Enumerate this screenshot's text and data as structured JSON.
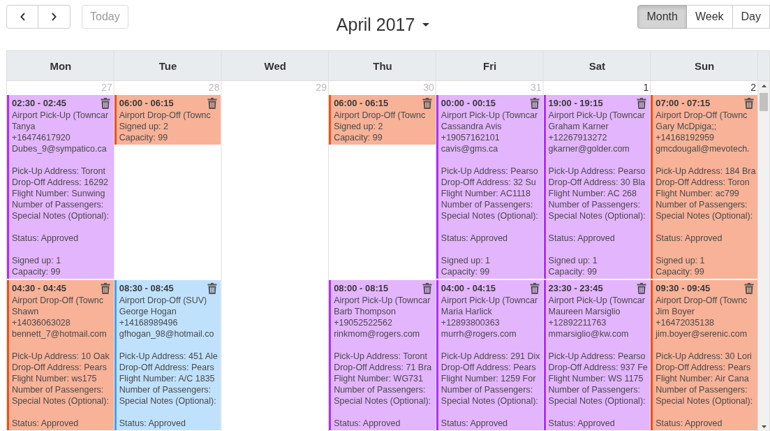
{
  "toolbar": {
    "today": {
      "label": "Today",
      "disabled": true
    },
    "title": "April 2017",
    "views": [
      {
        "label": "Month",
        "selected": true
      },
      {
        "label": "Week",
        "selected": false
      },
      {
        "label": "Day",
        "selected": false
      }
    ]
  },
  "weekdays": [
    "Mon",
    "Tue",
    "Wed",
    "Thu",
    "Fri",
    "Sat",
    "Sun"
  ],
  "days": [
    {
      "date": "27",
      "other_month": true,
      "events": [
        {
          "time": "02:30 - 02:45",
          "color": "#e3b5fd",
          "groups": [
            [
              "Airport Pick-Up (Towncar",
              "Tanya",
              "+16474617920",
              "Dubes_9@sympatico.ca"
            ],
            [
              "Pick-Up Address: Toront",
              "Drop-Off Address: 16292",
              "Flight Number: Sunwing",
              "Number of Passengers:",
              "Special Notes (Optional):"
            ],
            [
              "Status: Approved"
            ],
            [
              "Signed up: 1",
              "Capacity: 99"
            ]
          ]
        },
        {
          "time": "04:30 - 04:45",
          "color": "#f7b298",
          "groups": [
            [
              "Airport Drop-Off (Townc",
              "Shawn",
              "+14036063028",
              "bennett_7@hotmail.com"
            ],
            [
              "Pick-Up Address: 10 Oak",
              "Drop-Off Address: Pears",
              "Flight Number: ws175",
              "Number of Passengers:",
              "Special Notes (Optional):"
            ],
            [
              "Status: Approved"
            ]
          ]
        }
      ]
    },
    {
      "date": "28",
      "other_month": true,
      "events": [
        {
          "time": "06:00 - 06:15",
          "color": "#f7b298",
          "groups": [
            [
              "Airport Drop-Off (Townc",
              "Signed up: 2",
              "Capacity: 99"
            ]
          ]
        },
        {
          "time": "08:30 - 08:45",
          "color": "#bfe1fc",
          "groups": [
            [
              "Airport Drop-Off (SUV)",
              "George Hogan",
              "+14168989496",
              "gfhogan_98@hotmail.co"
            ],
            [
              "Pick-Up Address: 451 Ale",
              "Drop-Off Address: Pears",
              "Flight Number: A/C 1835",
              "Number of Passengers:",
              "Special Notes (Optional):"
            ],
            [
              "Status: Approved"
            ]
          ]
        }
      ]
    },
    {
      "date": "29",
      "other_month": true
    },
    {
      "date": "30",
      "other_month": true,
      "events": [
        {
          "time": "06:00 - 06:15",
          "color": "#f7b298",
          "groups": [
            [
              "Airport Drop-Off (Townc",
              "Signed up: 2",
              "Capacity: 99"
            ]
          ]
        },
        {
          "time": "08:00 - 08:15",
          "color": "#e3b5fd",
          "groups": [
            [
              "Airport Pick-Up (Towncar",
              "Barb Thompson",
              "+19052522562",
              "rinkmom@rogers.com"
            ],
            [
              "Pick-Up Address: Toront",
              "Drop-Off Address: 71 Bra",
              "Flight Number: WG731",
              "Number of Passengers:",
              "Special Notes (Optional):"
            ],
            [
              "Status: Approved"
            ]
          ]
        }
      ]
    },
    {
      "date": "31",
      "other_month": true,
      "events": [
        {
          "time": "00:00 - 00:15",
          "color": "#e3b5fd",
          "groups": [
            [
              "Airport Pick-Up (Towncar",
              "Cassandra Avis",
              "+19057162101",
              "cavis@gms.ca"
            ],
            [
              "Pick-Up Address: Pearso",
              "Drop-Off Address: 32 Su",
              "Flight Number: AC1118",
              "Number of Passengers:",
              "Special Notes (Optional):"
            ],
            [
              "Status: Approved"
            ],
            [
              "Signed up: 1",
              "Capacity: 99"
            ]
          ]
        },
        {
          "time": "04:00 - 04:15",
          "color": "#e3b5fd",
          "groups": [
            [
              "Airport Pick-Up (Towncar",
              "Maria Harlick",
              "+12893800363",
              "murrh@rogers.com"
            ],
            [
              "Pick-Up Address: 291 Dix",
              "Drop-Off Address: Pears",
              "Flight Number: 1259 For",
              "Number of Passengers:",
              "Special Notes (Optional):"
            ],
            [
              "Status: Approved"
            ]
          ]
        }
      ]
    },
    {
      "date": "1",
      "other_month": false,
      "events": [
        {
          "time": "19:00 - 19:15",
          "color": "#e3b5fd",
          "groups": [
            [
              "Airport Pick-Up (Towncar",
              "Graham Karner",
              "+12267913272",
              "gkarner@golder.com"
            ],
            [
              "Pick-Up Address: Pearso",
              "Drop-Off Address: 30 Bla",
              "Flight Number: AC 268",
              "Number of Passengers:",
              "Special Notes (Optional):"
            ],
            [
              "Status: Approved"
            ],
            [
              "Signed up: 1",
              "Capacity: 99"
            ]
          ]
        },
        {
          "time": "23:30 - 23:45",
          "color": "#e3b5fd",
          "groups": [
            [
              "Airport Pick-Up (Towncar",
              "Maureen Marsiglio",
              "+12892211763",
              "mmarsiglio@kw.com"
            ],
            [
              "Pick-Up Address: Pearso",
              "Drop-Off Address: 937 Fe",
              "Flight Number: WS 1175",
              "Number of Passengers:",
              "Special Notes (Optional):"
            ],
            [
              "Status: Approved"
            ]
          ]
        }
      ]
    },
    {
      "date": "2",
      "other_month": false,
      "events": [
        {
          "time": "07:00 - 07:15",
          "color": "#f7b298",
          "groups": [
            [
              "Airport Drop-Off (Townc",
              "Gary McDpiga;;",
              "+14168192959",
              "gmcdougall@mevotech."
            ],
            [
              "Pick-Up Address: 184 Bra",
              "Drop-Off Address: Toron",
              "Flight Number: ac799",
              "Number of Passengers:",
              "Special Notes (Optional):"
            ],
            [
              "Status: Approved"
            ],
            [
              "Signed up: 1",
              "Capacity: 99"
            ]
          ]
        },
        {
          "time": "09:30 - 09:45",
          "color": "#f7b298",
          "groups": [
            [
              "Airport Drop-Off (Townc",
              "Jim Boyer",
              "+16472035138",
              "jim.boyer@serenic.com"
            ],
            [
              "Pick-Up Address: 30 Lori",
              "Drop-Off Address: Pears",
              "Flight Number: Air Cana",
              "Number of Passengers:",
              "Special Notes (Optional):"
            ],
            [
              "Status: Approved"
            ]
          ]
        }
      ]
    }
  ]
}
